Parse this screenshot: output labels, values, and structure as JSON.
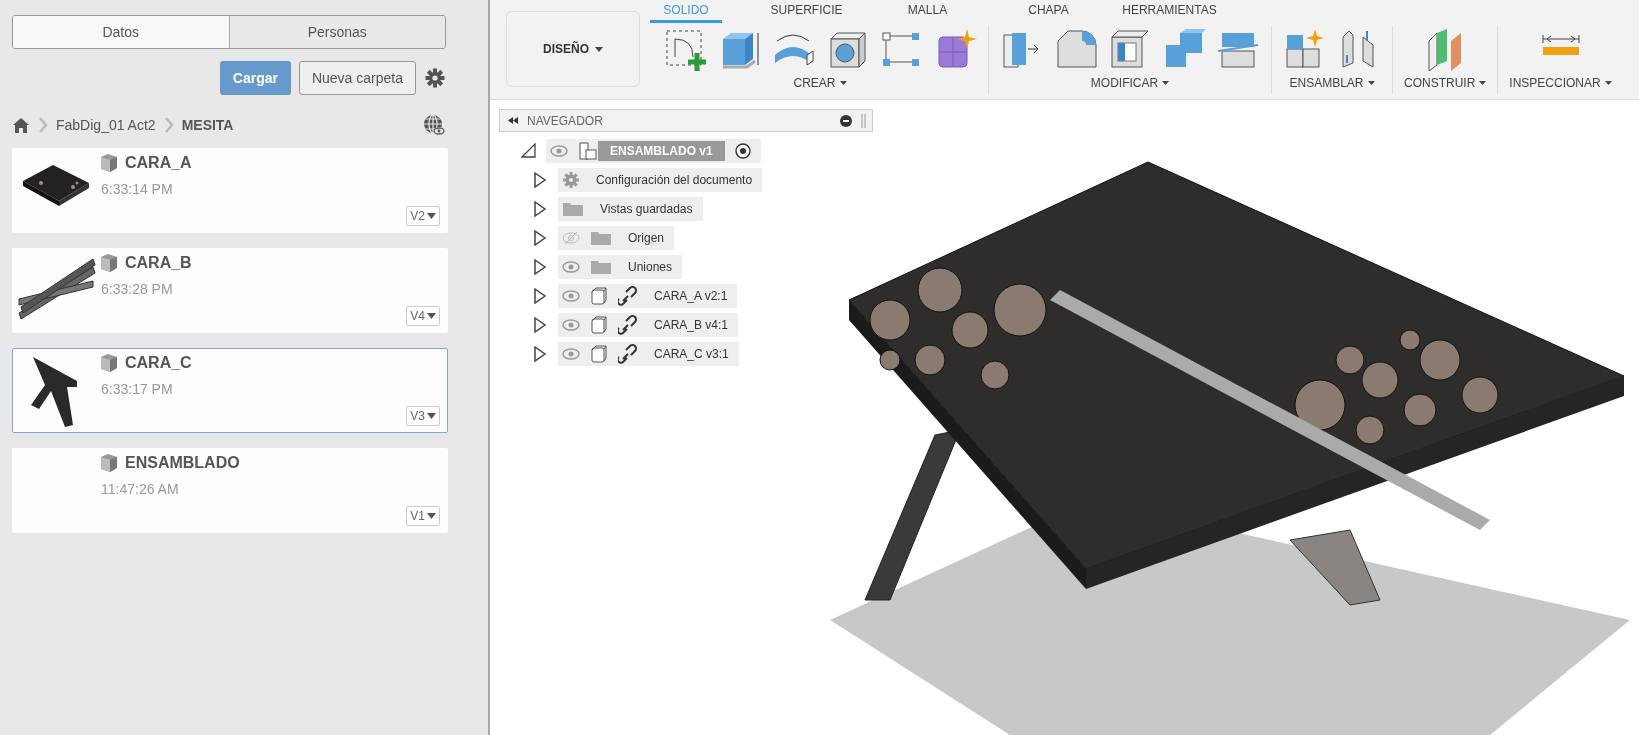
{
  "data_panel": {
    "tabs": [
      {
        "label": "Datos",
        "selected": true
      },
      {
        "label": "Personas",
        "selected": false
      }
    ],
    "upload_button": "Cargar",
    "new_folder_button": "Nueva carpeta",
    "breadcrumb": [
      "FabDig_01 Act2",
      "MESITA"
    ],
    "files": [
      {
        "name": "CARA_A",
        "time": "6:33:14 PM",
        "version": "V2",
        "kind": "plate",
        "selected": false
      },
      {
        "name": "CARA_B",
        "time": "6:33:28 PM",
        "version": "V4",
        "kind": "rails",
        "selected": false
      },
      {
        "name": "CARA_C",
        "time": "6:33:17 PM",
        "version": "V3",
        "kind": "stand",
        "selected": true
      },
      {
        "name": "ENSAMBLADO",
        "time": "11:47:26 AM",
        "version": "V1",
        "kind": "empty",
        "selected": false
      }
    ]
  },
  "toolbar": {
    "workspace": "DISEÑO",
    "tabs": [
      {
        "label": "SOLIDO",
        "selected": true
      },
      {
        "label": "SUPERFICIE",
        "selected": false
      },
      {
        "label": "MALLA",
        "selected": false
      },
      {
        "label": "CHAPA",
        "selected": false
      },
      {
        "label": "HERRAMIENTAS",
        "selected": false
      }
    ],
    "groups": [
      "CREAR",
      "MODIFICAR",
      "ENSAMBLAR",
      "CONSTRUIR",
      "INSPECCIONAR"
    ]
  },
  "browser": {
    "title": "NAVEGADOR",
    "root": {
      "label": "ENSAMBLADO v1",
      "expanded": true,
      "visible": true,
      "children": [
        {
          "label": "Configuración del documento",
          "kind": "settings",
          "expanded": false
        },
        {
          "label": "Vistas guardadas",
          "kind": "folder",
          "expanded": false
        },
        {
          "label": "Origen",
          "kind": "folder",
          "expanded": false,
          "visible": false
        },
        {
          "label": "Uniones",
          "kind": "folder",
          "expanded": false,
          "visible": true
        },
        {
          "label": "CARA_A v2:1",
          "kind": "component",
          "expanded": false,
          "visible": true
        },
        {
          "label": "CARA_B v4:1",
          "kind": "component",
          "expanded": false,
          "visible": true
        },
        {
          "label": "CARA_C v3:1",
          "kind": "component",
          "expanded": false,
          "visible": true
        }
      ]
    }
  }
}
